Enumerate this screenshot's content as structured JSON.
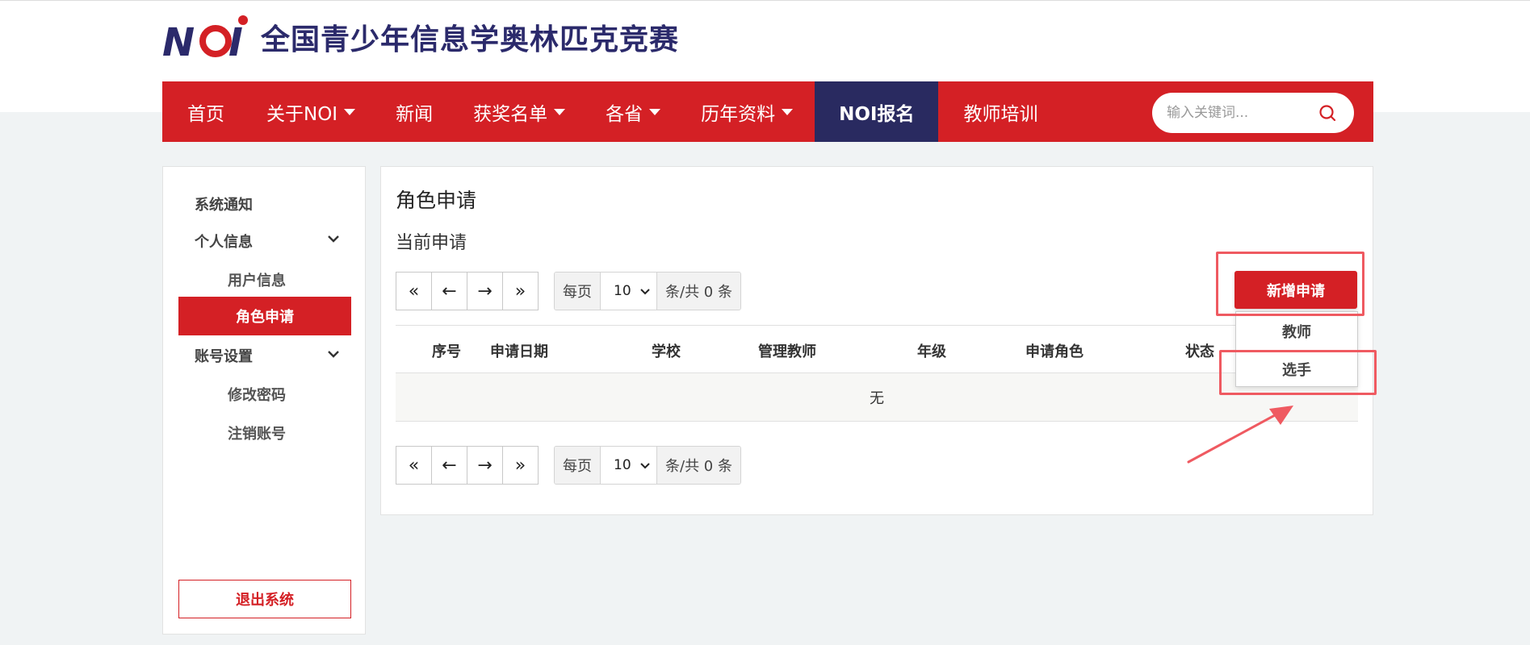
{
  "header": {
    "logo_text": "NOI",
    "site_title": "全国青少年信息学奥林匹克竞赛"
  },
  "nav": {
    "items": [
      {
        "label": "首页",
        "dropdown": false
      },
      {
        "label": "关于NOI",
        "dropdown": true
      },
      {
        "label": "新闻",
        "dropdown": false
      },
      {
        "label": "获奖名单",
        "dropdown": true
      },
      {
        "label": "各省",
        "dropdown": true
      },
      {
        "label": "历年资料",
        "dropdown": true
      },
      {
        "label": "NOI报名",
        "dropdown": false,
        "active": true
      },
      {
        "label": "教师培训",
        "dropdown": false
      }
    ],
    "search_placeholder": "输入关键词..."
  },
  "sidebar": {
    "system_notice": "系统通知",
    "personal_info": "个人信息",
    "user_info": "用户信息",
    "role_apply": "角色申请",
    "account_settings": "账号设置",
    "change_password": "修改密码",
    "deregister": "注销账号",
    "logout": "退出系统"
  },
  "main": {
    "page_title": "角色申请",
    "section_title": "当前申请",
    "pager": {
      "first": "«",
      "prev": "←",
      "next": "→",
      "last": "»",
      "per_page_label": "每页",
      "per_page_value": "10",
      "total_label": "条/共 0 条"
    },
    "table": {
      "headers": [
        "序号",
        "申请日期",
        "学校",
        "管理教师",
        "年级",
        "申请角色",
        "状态"
      ],
      "empty_text": "无"
    },
    "add_button": "新增申请",
    "add_menu": [
      "教师",
      "选手"
    ]
  },
  "colors": {
    "brand_red": "#d42025",
    "brand_navy": "#292a60",
    "highlight": "#ef5a61"
  }
}
